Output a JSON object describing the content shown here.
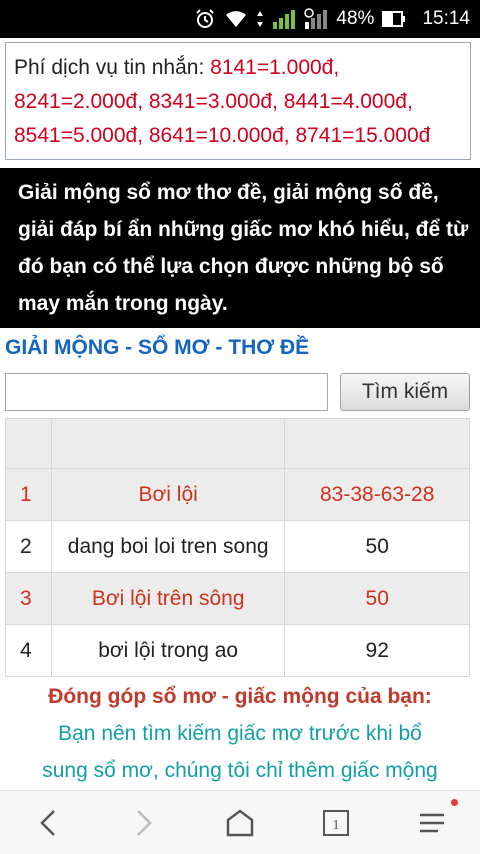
{
  "status_bar": {
    "icons": [
      "alarm-icon",
      "wifi-icon",
      "data-transfer-icon",
      "signal-sim1-icon",
      "signal-sim2-icon",
      "battery-icon"
    ],
    "battery": "48%",
    "time": "15:14"
  },
  "fee_box": {
    "label": "Phí dịch vụ tin nhắn: ",
    "line1_codes": "8141=1.000đ,",
    "line2": "8241=2.000đ, 8341=3.000đ, 8441=4.000đ,",
    "line3": "8541=5.000đ, 8641=10.000đ, 8741=15.000đ"
  },
  "intro": {
    "text": "Giải mộng sổ mơ thơ đề, giải mộng số đề, giải đáp bí ẩn những giấc mơ khó hiểu, để từ đó bạn có thể lựa chọn được những bộ số may mắn trong ngày."
  },
  "section": {
    "title": "GIẢI MỘNG - SỔ MƠ - THƠ ĐỀ"
  },
  "search": {
    "value": "",
    "placeholder": "",
    "button_label": "Tìm kiếm"
  },
  "results": {
    "rows": [
      {
        "index": "1",
        "dream": "Bơi lội",
        "numbers": "83-38-63-28"
      },
      {
        "index": "2",
        "dream": "dang boi loi tren song",
        "numbers": "50"
      },
      {
        "index": "3",
        "dream": "Bơi lội trên sông",
        "numbers": "50"
      },
      {
        "index": "4",
        "dream": "bơi lội trong ao",
        "numbers": "92"
      }
    ]
  },
  "contribute": {
    "title": "Đóng góp sổ mơ - giấc mộng của bạn:",
    "line1": "Bạn nên tìm kiếm giấc mơ trước khi bổ",
    "line2": "sung sổ mơ, chúng tôi chỉ thêm giấc mộng"
  },
  "nav_bar": {
    "tab_count": "1",
    "icons": [
      "back-icon",
      "forward-icon",
      "home-icon",
      "tabs-icon",
      "menu-icon"
    ],
    "colors": {
      "enabled": "#555555",
      "disabled": "#bbbbbb",
      "badge": "#e53935"
    }
  }
}
